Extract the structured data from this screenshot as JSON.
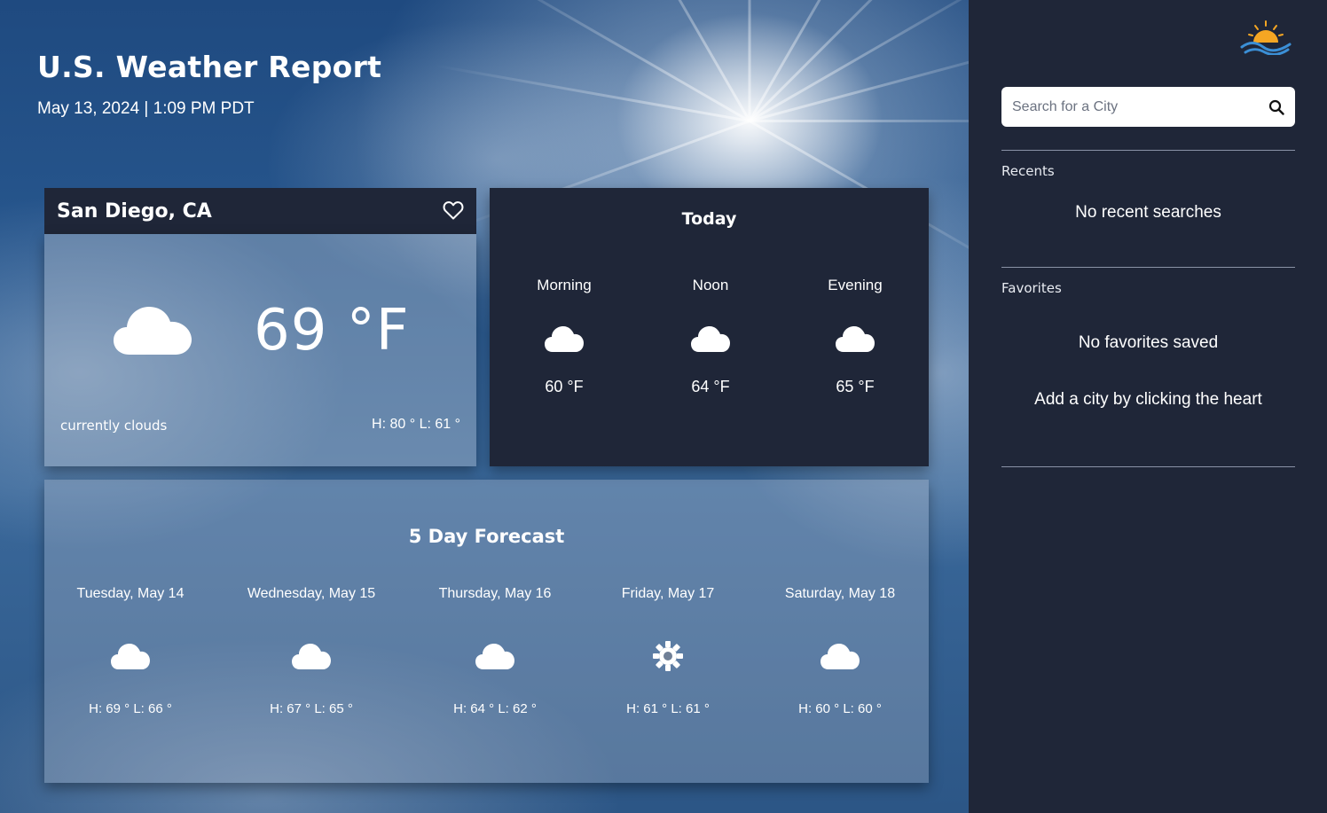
{
  "header": {
    "title": "U.S. Weather Report",
    "datetime": "May 13, 2024 | 1:09 PM PDT"
  },
  "current": {
    "city": "San Diego, CA",
    "icon": "cloud-icon",
    "temperature": "69 °F",
    "description": "currently clouds",
    "hilo": "H: 80 °  L: 61 °"
  },
  "today": {
    "title": "Today",
    "periods": [
      {
        "label": "Morning",
        "icon": "cloud-icon",
        "temp": "60 °F"
      },
      {
        "label": "Noon",
        "icon": "cloud-icon",
        "temp": "64 °F"
      },
      {
        "label": "Evening",
        "icon": "cloud-icon",
        "temp": "65 °F"
      }
    ]
  },
  "forecast": {
    "title": "5 Day Forecast",
    "days": [
      {
        "label": "Tuesday, May 14",
        "icon": "cloud-icon",
        "hilo": "H: 69 °   L: 66 °"
      },
      {
        "label": "Wednesday, May 15",
        "icon": "cloud-icon",
        "hilo": "H: 67 °   L: 65 °"
      },
      {
        "label": "Thursday, May 16",
        "icon": "cloud-icon",
        "hilo": "H: 64 °   L: 62 °"
      },
      {
        "label": "Friday, May 17",
        "icon": "sun-icon",
        "hilo": "H: 61 °   L: 61 °"
      },
      {
        "label": "Saturday, May 18",
        "icon": "cloud-icon",
        "hilo": "H: 60 °   L: 60 °"
      }
    ]
  },
  "sidebar": {
    "search_placeholder": "Search for a City",
    "recents_label": "Recents",
    "recents_empty": "No recent searches",
    "favorites_label": "Favorites",
    "favorites_empty": "No favorites saved",
    "favorites_hint": "Add a city by clicking the heart"
  },
  "colors": {
    "panel": "#1f2638",
    "sky": "#28588f",
    "logo_sun": "#f5a623",
    "logo_wave": "#3b8fd6"
  }
}
